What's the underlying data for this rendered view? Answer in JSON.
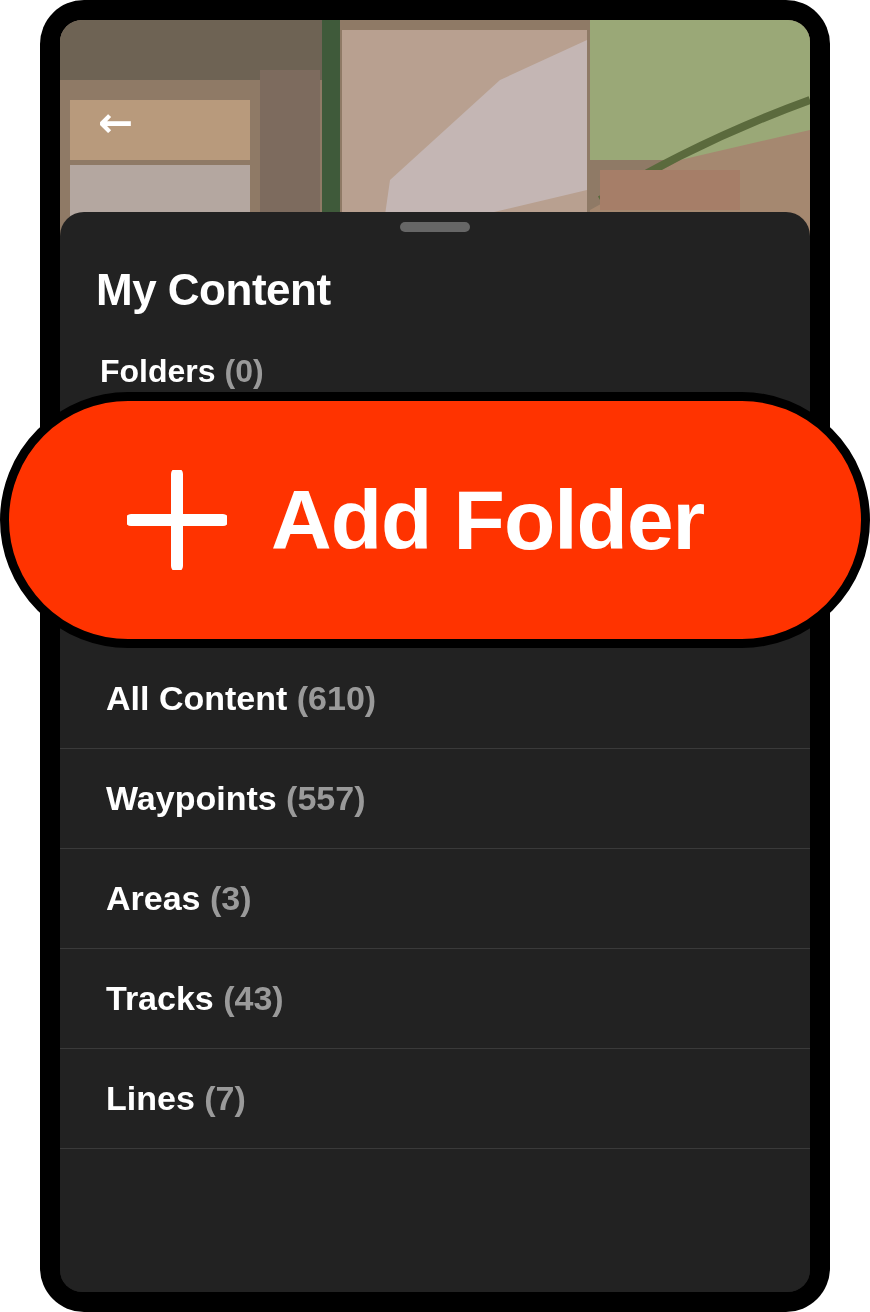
{
  "header": {
    "back_icon": "←"
  },
  "title": "My Content",
  "folders": {
    "label": "Folders",
    "count": "(0)"
  },
  "add_button": {
    "label": "Add Folder"
  },
  "categories": [
    {
      "label": "All Content",
      "count": "(610)"
    },
    {
      "label": "Waypoints",
      "count": "(557)"
    },
    {
      "label": "Areas",
      "count": "(3)"
    },
    {
      "label": "Tracks",
      "count": "(43)"
    },
    {
      "label": "Lines",
      "count": "(7)"
    }
  ]
}
